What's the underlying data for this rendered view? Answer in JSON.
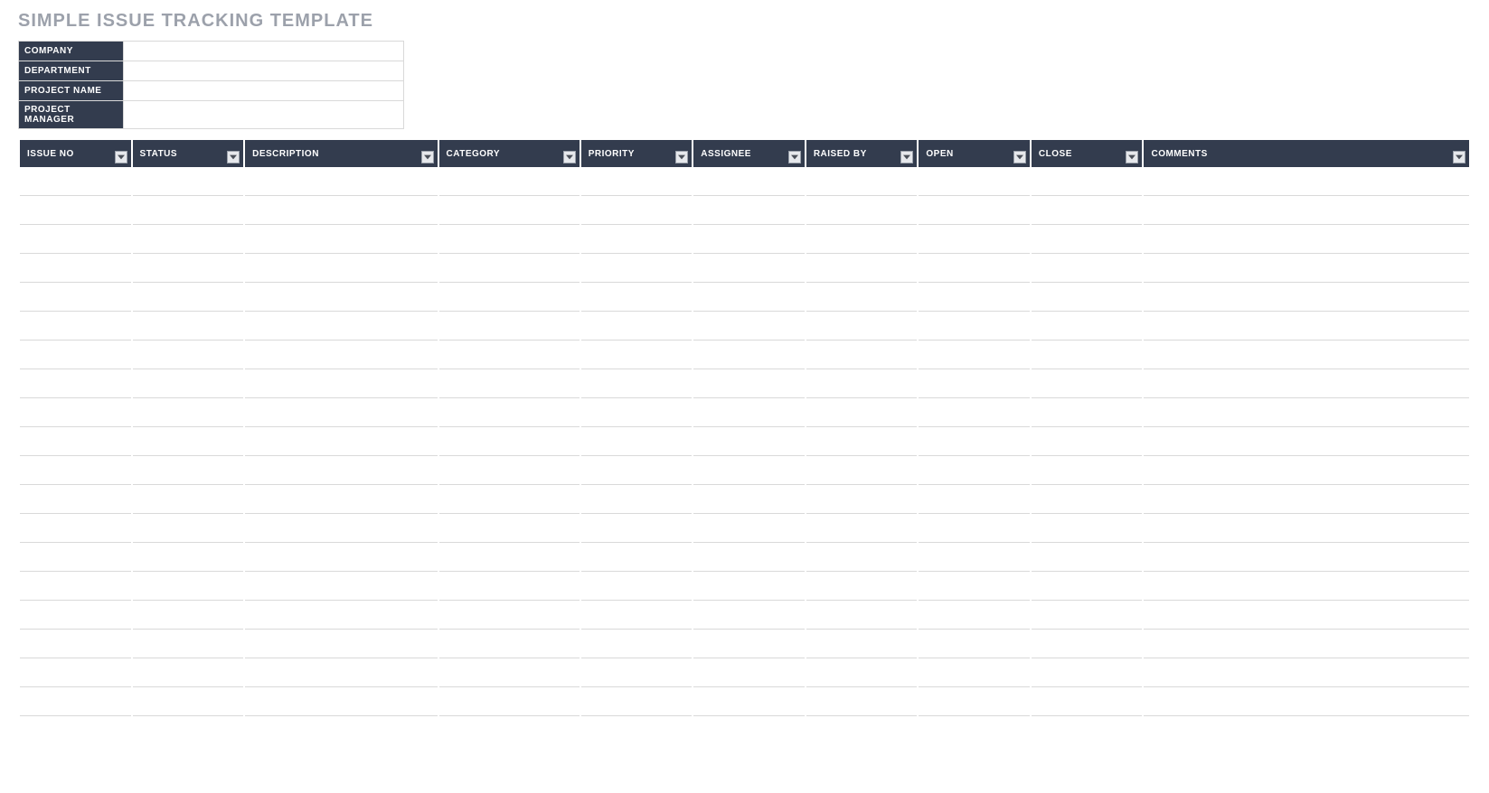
{
  "title": "SIMPLE ISSUE TRACKING TEMPLATE",
  "info": {
    "fields": [
      {
        "label": "COMPANY",
        "value": ""
      },
      {
        "label": "DEPARTMENT",
        "value": ""
      },
      {
        "label": "PROJECT NAME",
        "value": ""
      },
      {
        "label": "PROJECT MANAGER",
        "value": ""
      }
    ]
  },
  "table": {
    "columns": [
      "ISSUE NO",
      "STATUS",
      "DESCRIPTION",
      "CATEGORY",
      "PRIORITY",
      "ASSIGNEE",
      "RAISED BY",
      "OPEN",
      "CLOSE",
      "COMMENTS"
    ],
    "rows": [
      [
        "",
        "",
        "",
        "",
        "",
        "",
        "",
        "",
        "",
        ""
      ],
      [
        "",
        "",
        "",
        "",
        "",
        "",
        "",
        "",
        "",
        ""
      ],
      [
        "",
        "",
        "",
        "",
        "",
        "",
        "",
        "",
        "",
        ""
      ],
      [
        "",
        "",
        "",
        "",
        "",
        "",
        "",
        "",
        "",
        ""
      ],
      [
        "",
        "",
        "",
        "",
        "",
        "",
        "",
        "",
        "",
        ""
      ],
      [
        "",
        "",
        "",
        "",
        "",
        "",
        "",
        "",
        "",
        ""
      ],
      [
        "",
        "",
        "",
        "",
        "",
        "",
        "",
        "",
        "",
        ""
      ],
      [
        "",
        "",
        "",
        "",
        "",
        "",
        "",
        "",
        "",
        ""
      ],
      [
        "",
        "",
        "",
        "",
        "",
        "",
        "",
        "",
        "",
        ""
      ],
      [
        "",
        "",
        "",
        "",
        "",
        "",
        "",
        "",
        "",
        ""
      ],
      [
        "",
        "",
        "",
        "",
        "",
        "",
        "",
        "",
        "",
        ""
      ],
      [
        "",
        "",
        "",
        "",
        "",
        "",
        "",
        "",
        "",
        ""
      ],
      [
        "",
        "",
        "",
        "",
        "",
        "",
        "",
        "",
        "",
        ""
      ],
      [
        "",
        "",
        "",
        "",
        "",
        "",
        "",
        "",
        "",
        ""
      ],
      [
        "",
        "",
        "",
        "",
        "",
        "",
        "",
        "",
        "",
        ""
      ],
      [
        "",
        "",
        "",
        "",
        "",
        "",
        "",
        "",
        "",
        ""
      ],
      [
        "",
        "",
        "",
        "",
        "",
        "",
        "",
        "",
        "",
        ""
      ],
      [
        "",
        "",
        "",
        "",
        "",
        "",
        "",
        "",
        "",
        ""
      ],
      [
        "",
        "",
        "",
        "",
        "",
        "",
        "",
        "",
        "",
        ""
      ]
    ]
  }
}
